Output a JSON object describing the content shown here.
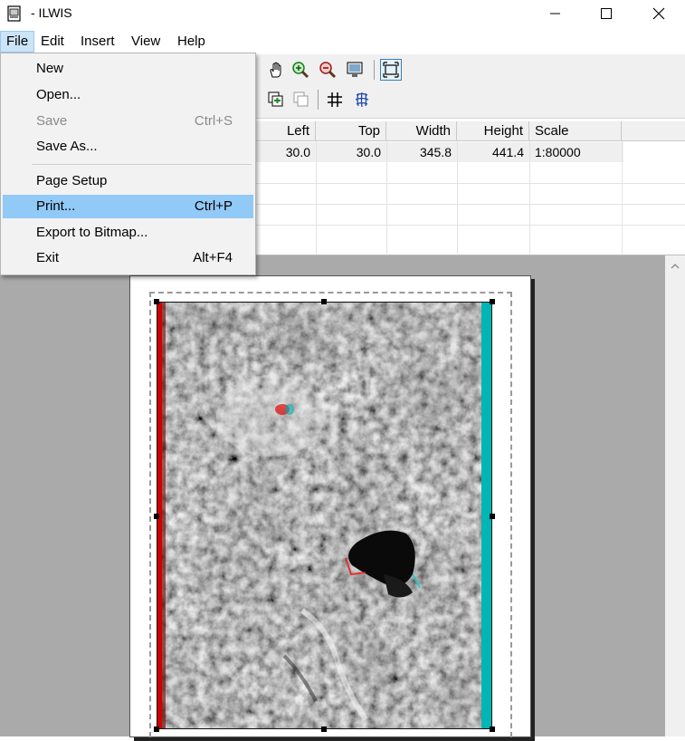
{
  "window": {
    "title": "- ILWIS"
  },
  "menubar": {
    "file": "File",
    "edit": "Edit",
    "insert": "Insert",
    "view": "View",
    "help": "Help"
  },
  "file_menu": {
    "new": "New",
    "open": "Open...",
    "save": "Save",
    "save_shortcut": "Ctrl+S",
    "save_as": "Save As...",
    "page_setup": "Page Setup",
    "print": "Print...",
    "print_shortcut": "Ctrl+P",
    "export": "Export to Bitmap...",
    "exit": "Exit",
    "exit_shortcut": "Alt+F4"
  },
  "table": {
    "headers": {
      "left": "Left",
      "top": "Top",
      "width": "Width",
      "height": "Height",
      "scale": "Scale"
    },
    "row1": {
      "left": "30.0",
      "top": "30.0",
      "width": "345.8",
      "height": "441.4",
      "scale": "1:80000"
    }
  },
  "colors": {
    "highlight": "#91c9f7",
    "menu_open": "#cce4f7",
    "canvas": "#aaaaaa"
  }
}
